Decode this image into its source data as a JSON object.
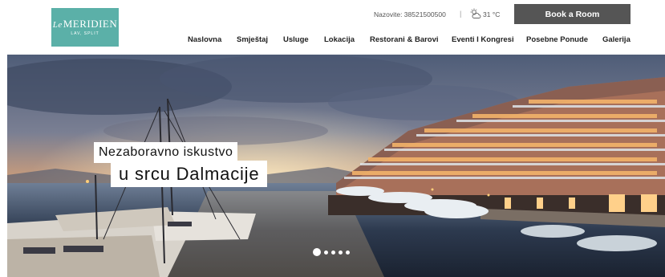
{
  "brand": {
    "logo_prefix": "Le",
    "logo_name": "MERIDIEN",
    "logo_location": "LAV, SPLIT",
    "logo_color": "#5bb0a8"
  },
  "topbar": {
    "phone": "Nazovite: 38521500500",
    "separator": "|",
    "weather_icon": "cloud-sun-icon",
    "temperature": "31 °C",
    "book_button": "Book a Room",
    "book_button_color": "#555555"
  },
  "nav": {
    "items": [
      {
        "label": "Naslovna"
      },
      {
        "label": "Smještaj"
      },
      {
        "label": "Usluge"
      },
      {
        "label": "Lokacija"
      },
      {
        "label": "Restorani & Barovi"
      },
      {
        "label": "Eventi I Kongresi"
      },
      {
        "label": "Posebne Ponude"
      },
      {
        "label": "Galerija"
      }
    ]
  },
  "hero": {
    "caption_line1": "Nezaboravno iskustvo",
    "caption_line2": "u srcu Dalmacije",
    "slides_total": 5,
    "active_slide": 1
  }
}
